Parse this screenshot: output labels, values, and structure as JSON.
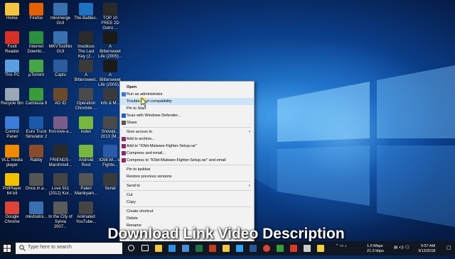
{
  "desktop": {
    "icons": [
      {
        "label": "Home",
        "color": "#f5c542"
      },
      {
        "label": "Foxit Reader",
        "color": "#d93025"
      },
      {
        "label": "This PC",
        "color": "#5aa0e0"
      },
      {
        "label": "Recycle Bin",
        "color": "#9aa7b5"
      },
      {
        "label": "Control Panel",
        "color": "#3b7dd8"
      },
      {
        "label": "VLC media player",
        "color": "#f08a00"
      },
      {
        "label": "PotPlayer 64 bit",
        "color": "#f2c200"
      },
      {
        "label": "Google Chrome",
        "color": "#db4437"
      },
      {
        "label": "Firefox",
        "color": "#e66000"
      },
      {
        "label": "Internet Downlo...",
        "color": "#2c8f3f"
      },
      {
        "label": "µTorrent",
        "color": "#47a548"
      },
      {
        "label": "Camtasia 9",
        "color": "#3a9b3a"
      },
      {
        "label": "Euro Truck Simulator 2",
        "color": "#1b5aa8"
      },
      {
        "label": "Rabby",
        "color": "#8a4b2a"
      },
      {
        "label": "Once.in.a...",
        "color": "#555555"
      },
      {
        "label": "mkvtoolni...",
        "color": "#3a6fb0"
      },
      {
        "label": "mkvmerge GUI",
        "color": "#3a6fb0"
      },
      {
        "label": "MKVToolNix GUI",
        "color": "#3a6fb0"
      },
      {
        "label": "Captu",
        "color": "#2b5c9c"
      },
      {
        "label": "AD ID",
        "color": "#6b4a2a"
      },
      {
        "label": "first-love-a...",
        "color": "#7a5c8a"
      },
      {
        "label": "FRIENDS - Marshmell...",
        "color": "#2a2a2a"
      },
      {
        "label": "Love 911 (2012) Kor...",
        "color": "#444444"
      },
      {
        "label": "In the City of Sylvia 2007...",
        "color": "#5a5a5a"
      },
      {
        "label": "The.Battles...",
        "color": "#1c73c4"
      },
      {
        "label": "Insidious The Last Key (2...",
        "color": "#2a2a2a"
      },
      {
        "label": "A Bittersweet...",
        "color": "#3a3a3a"
      },
      {
        "label": "Operation Chromite ...",
        "color": "#4a4a4a"
      },
      {
        "label": "index",
        "color": "#78b83e"
      },
      {
        "label": "Android Root",
        "color": "#78b83e"
      },
      {
        "label": "Paleri Manikyam...",
        "color": "#555555"
      },
      {
        "label": "Animated YouTube...",
        "color": "#444444"
      },
      {
        "label": "TOP 10 FREE 2D Outro ...",
        "color": "#2a2a2a"
      },
      {
        "label": "A Bittersweet Life (2005)...",
        "color": "#1a1a1a"
      },
      {
        "label": "A Bittersweet Life (2005)...",
        "color": "#1a1a1a"
      },
      {
        "label": "Info & M...",
        "color": "#3a3a3a"
      },
      {
        "label": "Snowpi... 2013 [M...",
        "color": "#4a4a4a"
      },
      {
        "label": "IObit-M... e-Fighte...",
        "color": "#2a5aa8"
      },
      {
        "label": "Serial",
        "color": "#3a3a3a"
      }
    ]
  },
  "context_menu": {
    "items": [
      {
        "label": "Open",
        "bold": true
      },
      {
        "label": "Run as administrator",
        "icon": "shield-icon"
      },
      {
        "label": "Troubleshoot compatibility",
        "highlighted": true
      },
      {
        "label": "Pin to Start"
      },
      {
        "label": "Scan with Windows Defender...",
        "icon": "defender-icon"
      },
      {
        "label": "Share",
        "icon": "share-icon"
      },
      {
        "label": "Give access to",
        "submenu": true
      },
      {
        "label": "Add to archive...",
        "icon": "archive-icon"
      },
      {
        "label": "Add to \"IObit-Malware-Fighter-Setup.rar\"",
        "icon": "archive-icon"
      },
      {
        "label": "Compress and email...",
        "icon": "archive-icon"
      },
      {
        "label": "Compress to \"IObit-Malware-Fighter-Setup.rar\" and email",
        "icon": "archive-icon"
      },
      {
        "label": "Pin to taskbar"
      },
      {
        "label": "Restore previous versions"
      },
      {
        "label": "Send to",
        "submenu": true
      },
      {
        "label": "Cut"
      },
      {
        "label": "Copy"
      },
      {
        "label": "Create shortcut"
      },
      {
        "label": "Delete"
      },
      {
        "label": "Rename"
      },
      {
        "label": "Properties"
      }
    ],
    "highlight_color": "#cce4f7"
  },
  "overlay": {
    "text": "Download Link Video Description"
  },
  "taskbar": {
    "search_placeholder": "Type here to search",
    "apps": [
      "cortana-icon",
      "task-view-icon",
      "file-explorer-icon",
      "edge-icon",
      "store-icon",
      "excel-icon",
      "powerpoint-icon",
      "folder-icon",
      "photoshop-icon",
      "word-icon",
      "chrome-icon",
      "camtasia-icon",
      "adobe-icon",
      "settings-icon",
      "notes-icon"
    ],
    "net_up": "1.0 Mbps",
    "net_down": "21.0 kbps",
    "time": "9:57 AM",
    "date": "3/13/2018"
  }
}
